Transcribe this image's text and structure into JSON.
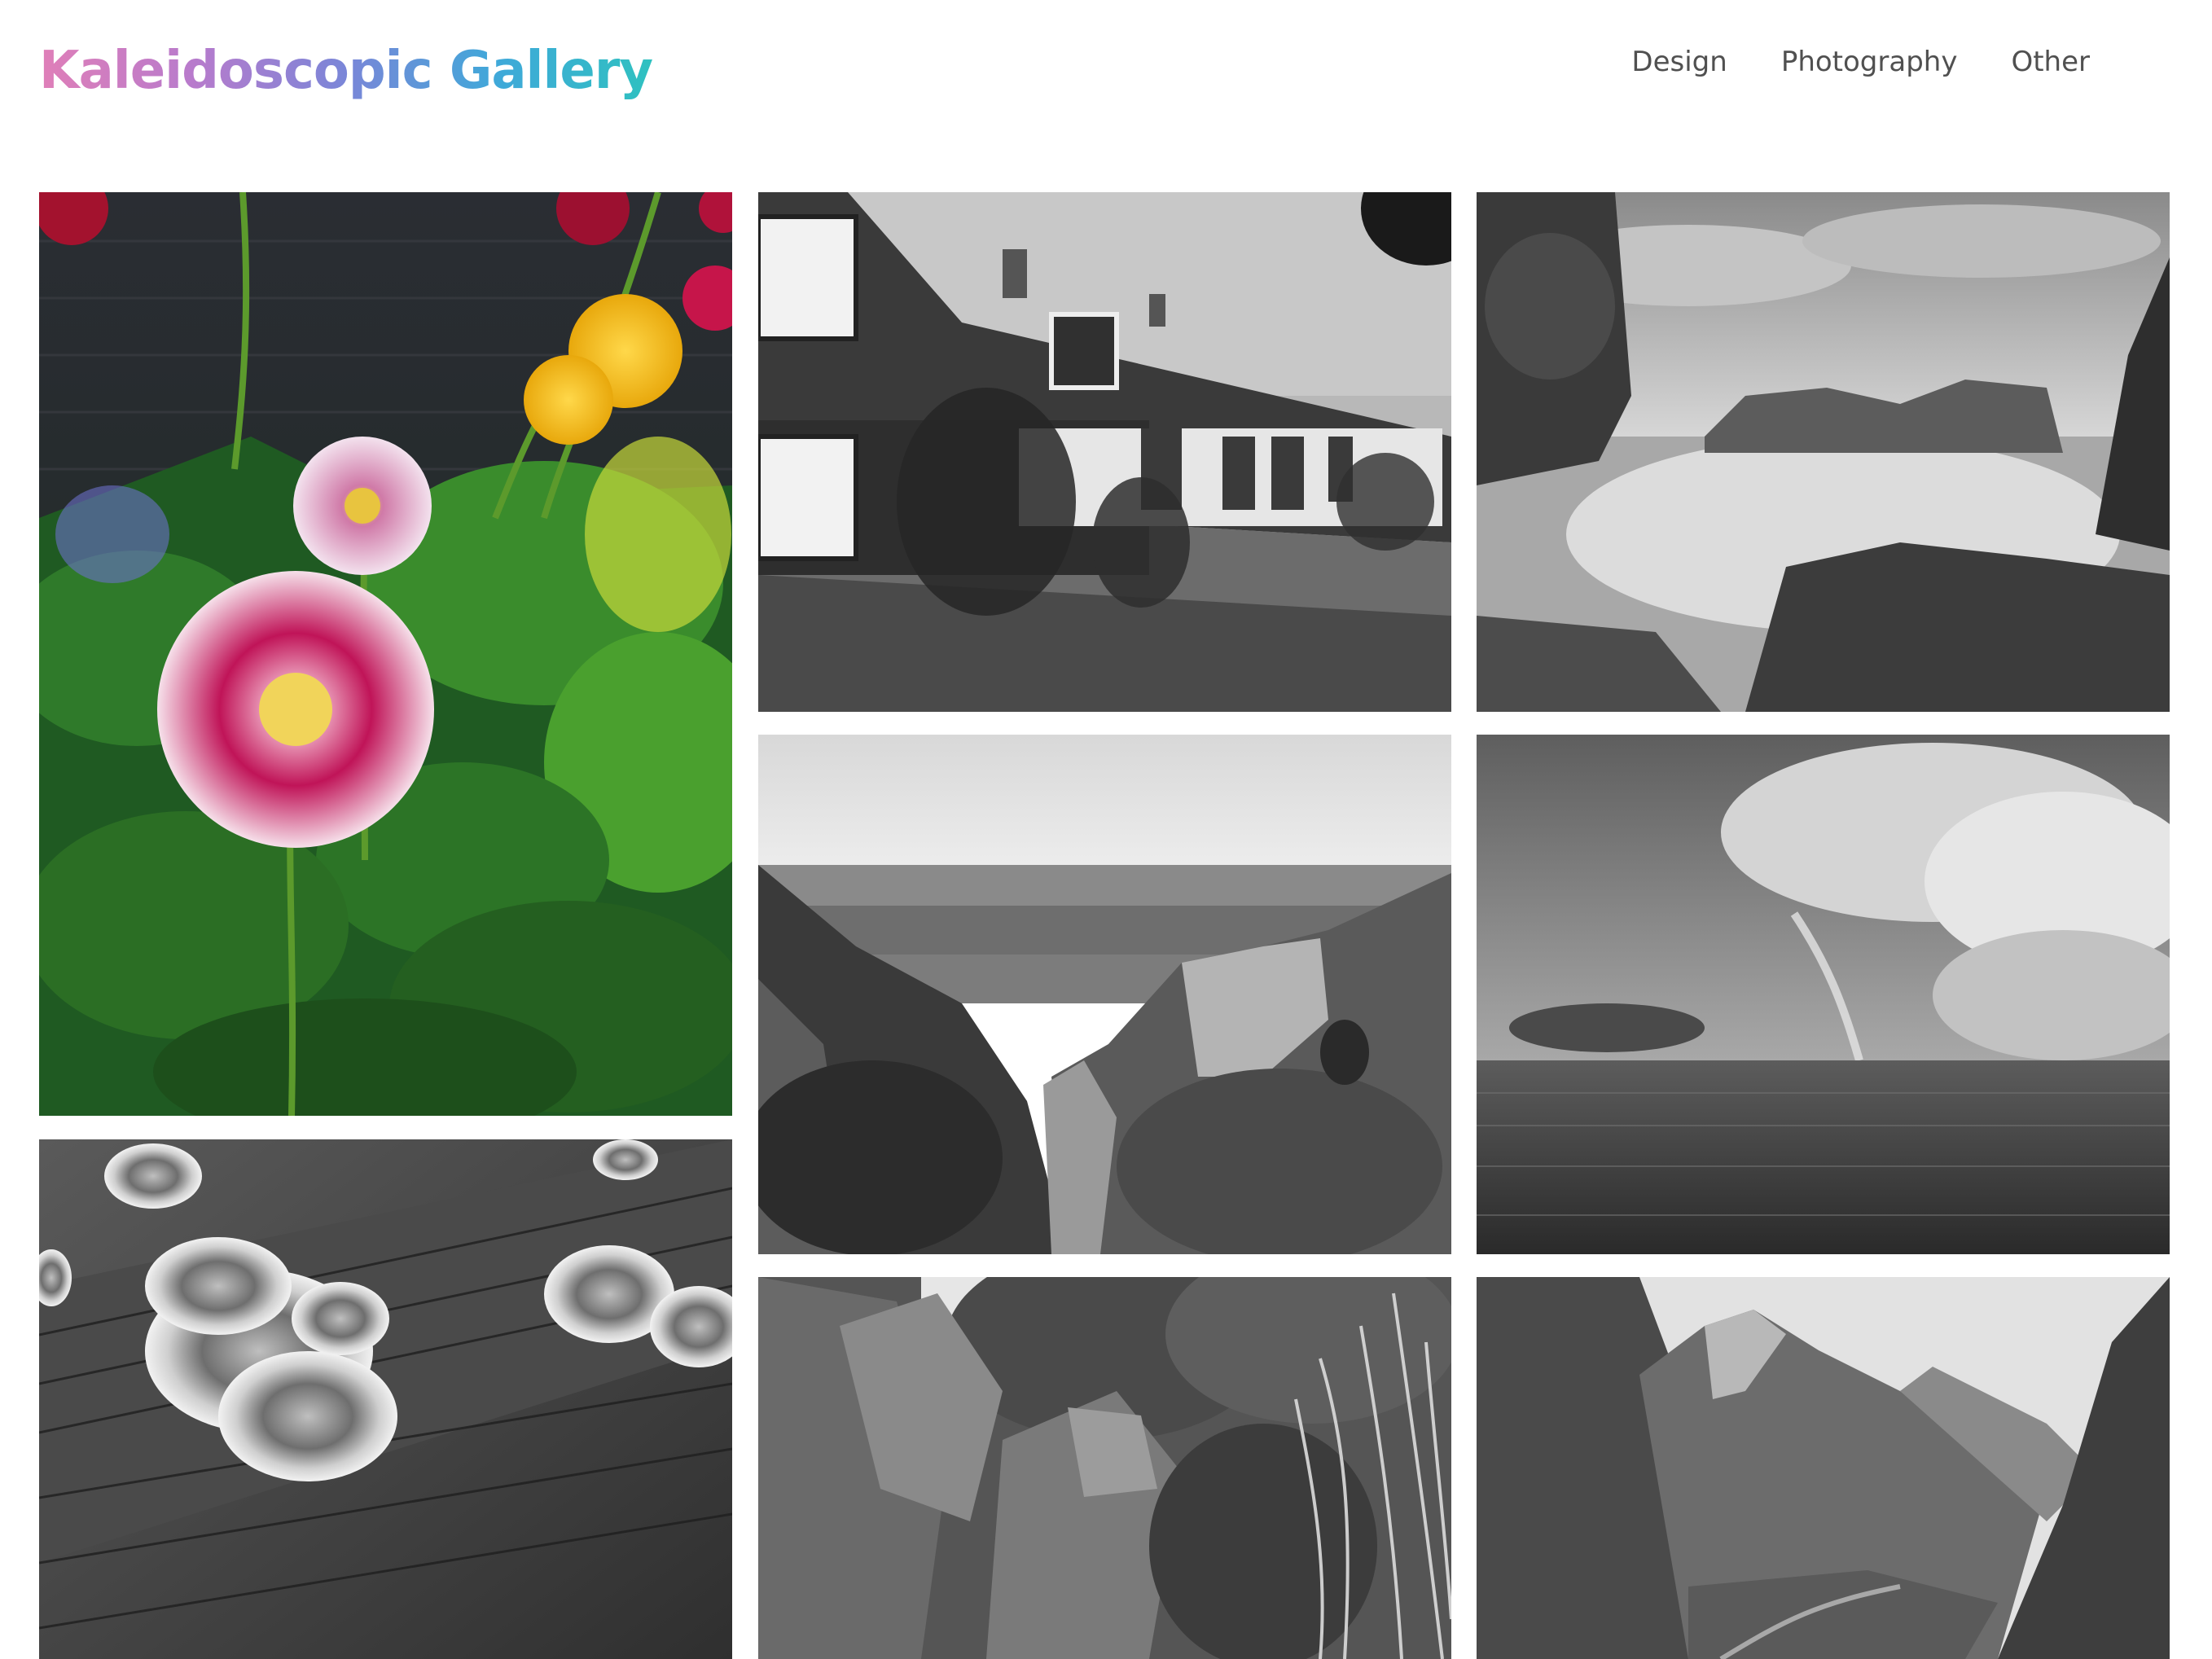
{
  "site": {
    "title": "Kaleidoscopic Gallery"
  },
  "nav": {
    "items": [
      {
        "label": "Design"
      },
      {
        "label": "Photography"
      },
      {
        "label": "Other"
      }
    ]
  },
  "gallery": {
    "photos": [
      {
        "subject": "dahlia flowers",
        "color": "full color"
      },
      {
        "subject": "row of cottages",
        "color": "grayscale"
      },
      {
        "subject": "rocky coastline",
        "color": "grayscale"
      },
      {
        "subject": "bracket fungus on log",
        "color": "grayscale"
      },
      {
        "subject": "canyon overlook",
        "color": "grayscale"
      },
      {
        "subject": "rainbow over sea",
        "color": "grayscale"
      },
      {
        "subject": "rocks and palm fronds",
        "color": "grayscale"
      },
      {
        "subject": "mountain valley",
        "color": "grayscale"
      }
    ]
  },
  "colors": {
    "logo_gradient": [
      "#e07fb8",
      "#7a86d8",
      "#2fc1c0"
    ],
    "nav_text": "#505050",
    "background": "#ffffff"
  }
}
